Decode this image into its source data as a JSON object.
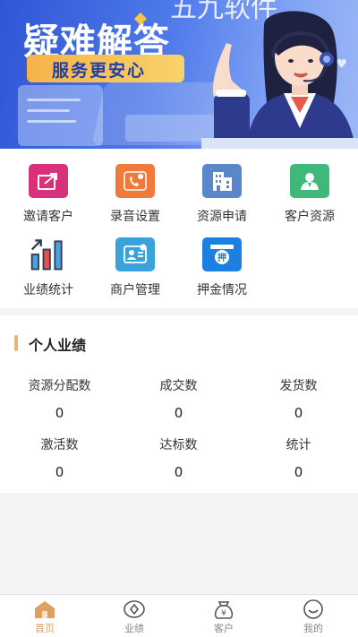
{
  "banner": {
    "title": "疑难解答",
    "subtitle": "服务更安心",
    "watermark": "五九软件"
  },
  "menu": {
    "items": [
      {
        "label": "邀请客户",
        "icon": "share-icon",
        "color": "#d8307a"
      },
      {
        "label": "录音设置",
        "icon": "phone-record-icon",
        "color": "#f07a3c"
      },
      {
        "label": "资源申请",
        "icon": "building-icon",
        "color": "#5a86cc"
      },
      {
        "label": "客户资源",
        "icon": "customer-icon",
        "color": "#3fb97a"
      },
      {
        "label": "业绩统计",
        "icon": "bar-chart-icon",
        "color": "#2c3c55"
      },
      {
        "label": "商户管理",
        "icon": "merchant-card-icon",
        "color": "#3aa3db"
      },
      {
        "label": "押金情况",
        "icon": "deposit-box-icon",
        "color": "#1d7fe0"
      }
    ]
  },
  "performance": {
    "title": "个人业绩",
    "stats": [
      {
        "label": "资源分配数",
        "value": "0"
      },
      {
        "label": "成交数",
        "value": "0"
      },
      {
        "label": "发货数",
        "value": "0"
      },
      {
        "label": "激活数",
        "value": "0"
      },
      {
        "label": "达标数",
        "value": "0"
      },
      {
        "label": "统计",
        "value": "0"
      }
    ]
  },
  "tabbar": {
    "active_color": "#e0a060",
    "tabs": [
      {
        "label": "首页",
        "icon": "home-icon"
      },
      {
        "label": "业绩",
        "icon": "performance-icon"
      },
      {
        "label": "客户",
        "icon": "money-bag-icon"
      },
      {
        "label": "我的",
        "icon": "profile-icon"
      }
    ]
  }
}
